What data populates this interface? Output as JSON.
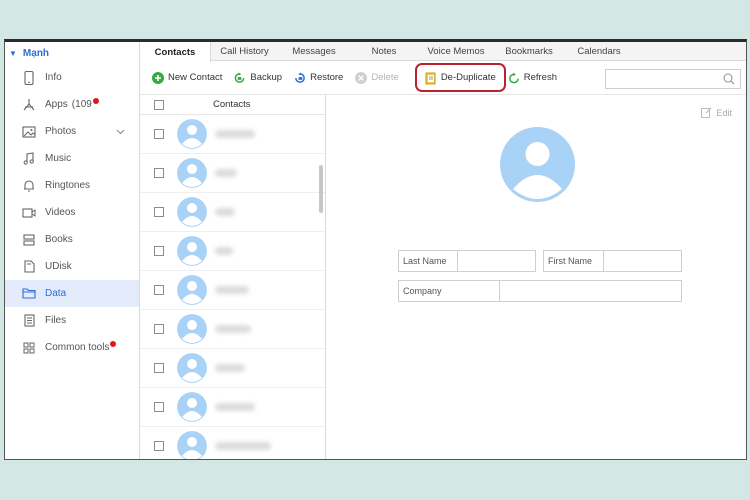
{
  "sidebar": {
    "device_name": "Mạnh",
    "items": [
      {
        "label": "Info",
        "icon": "phone-icon"
      },
      {
        "label": "Apps",
        "badge": "(109",
        "icon": "apps-icon"
      },
      {
        "label": "Photos",
        "icon": "photos-icon"
      },
      {
        "label": "Music",
        "icon": "music-icon"
      },
      {
        "label": "Ringtones",
        "icon": "bell-icon"
      },
      {
        "label": "Videos",
        "icon": "video-icon"
      },
      {
        "label": "Books",
        "icon": "books-icon"
      },
      {
        "label": "UDisk",
        "icon": "udisk-icon"
      },
      {
        "label": "Data",
        "icon": "folder-icon"
      },
      {
        "label": "Files",
        "icon": "file-icon"
      },
      {
        "label": "Common tools",
        "icon": "tools-icon"
      }
    ],
    "active_item": "Data",
    "accent": "#2b6fd6",
    "notification_color": "#e0151d"
  },
  "tabs": [
    "Contacts",
    "Call History",
    "Messages",
    "Notes",
    "Voice Memos",
    "Bookmarks",
    "Calendars"
  ],
  "active_tab": "Contacts",
  "toolbar": {
    "new_contact": "New Contact",
    "backup": "Backup",
    "restore": "Restore",
    "delete": "Delete",
    "deduplicate": "De-Duplicate",
    "refresh": "Refresh",
    "highlight_color": "#b82231"
  },
  "search": {
    "placeholder": ""
  },
  "contacts_list": {
    "header": "Contacts",
    "row_count": 9
  },
  "detail": {
    "edit_label": "Edit",
    "last_name_label": "Last Name",
    "first_name_label": "First Name",
    "company_label": "Company",
    "last_name_value": "",
    "first_name_value": "",
    "company_value": ""
  },
  "avatar_color": "#a9d2f7"
}
